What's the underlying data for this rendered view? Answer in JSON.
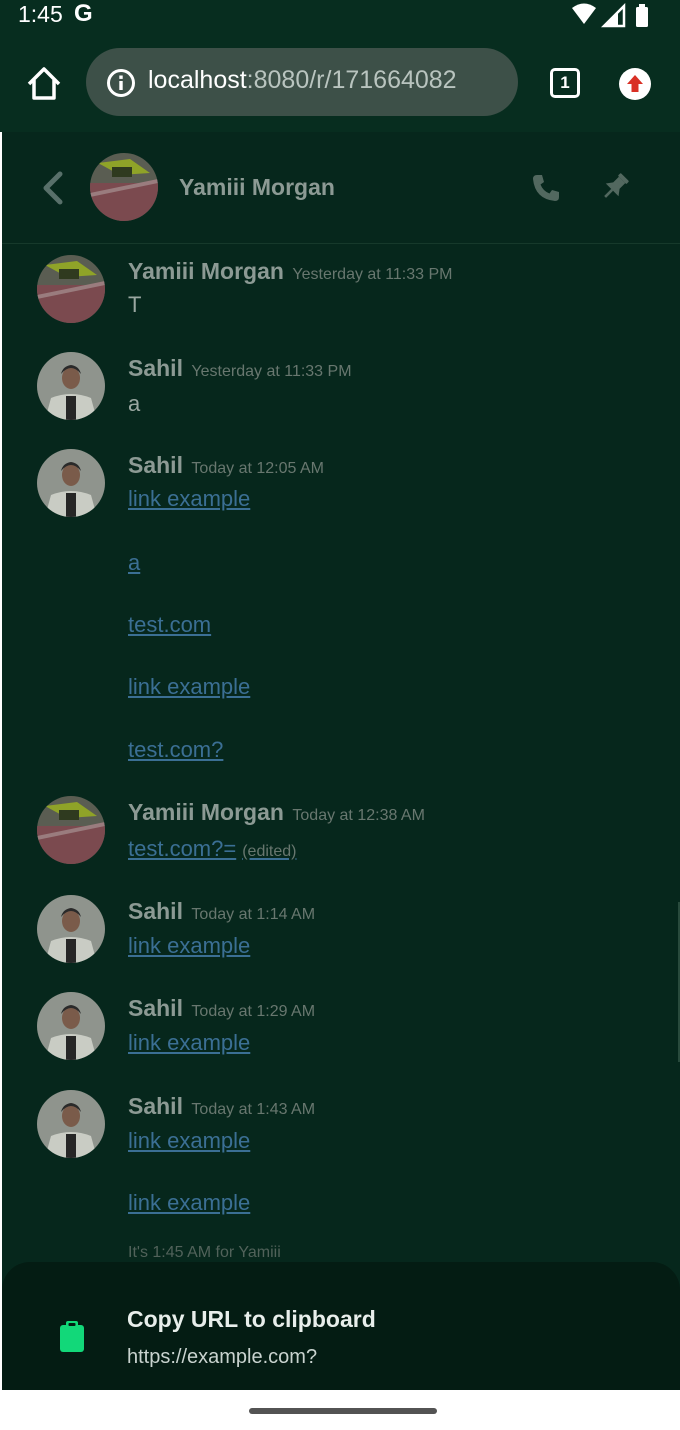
{
  "status_bar": {
    "time": "1:45",
    "g_label": "G"
  },
  "browser": {
    "url_host": "localhost",
    "url_rest": ":8080/r/171664082",
    "tab_count": "1"
  },
  "chat": {
    "title": "Yamiii Morgan",
    "messages": [
      {
        "author": "Yamiii Morgan",
        "time": "Yesterday at 11:33 PM",
        "lines": [
          "T"
        ]
      },
      {
        "author": "Sahil",
        "time": "Yesterday at 11:33 PM",
        "lines": [
          "a"
        ]
      },
      {
        "author": "Sahil",
        "time": "Today at 12:05 AM",
        "lines": [
          "link example",
          "a",
          "test.com",
          "link example",
          "test.com?"
        ]
      },
      {
        "author": "Yamiii Morgan",
        "time": "Today at 12:38 AM",
        "lines": [
          "test.com?="
        ],
        "edited": "(edited)"
      },
      {
        "author": "Sahil",
        "time": "Today at 1:14 AM",
        "lines": [
          "link example"
        ]
      },
      {
        "author": "Sahil",
        "time": "Today at 1:29 AM",
        "lines": [
          "link example"
        ]
      },
      {
        "author": "Sahil",
        "time": "Today at 1:43 AM",
        "lines": [
          "link example",
          "link example"
        ]
      }
    ],
    "local_time_note": "It's 1:45 AM for Yamiii"
  },
  "bottom_sheet": {
    "title": "Copy URL to clipboard",
    "url": "https://example.com?"
  },
  "colors": {
    "page_bg": "#06271c",
    "link": "#3b6f94",
    "clipboard_accent": "#12d879",
    "update_badge": "#d93025"
  }
}
